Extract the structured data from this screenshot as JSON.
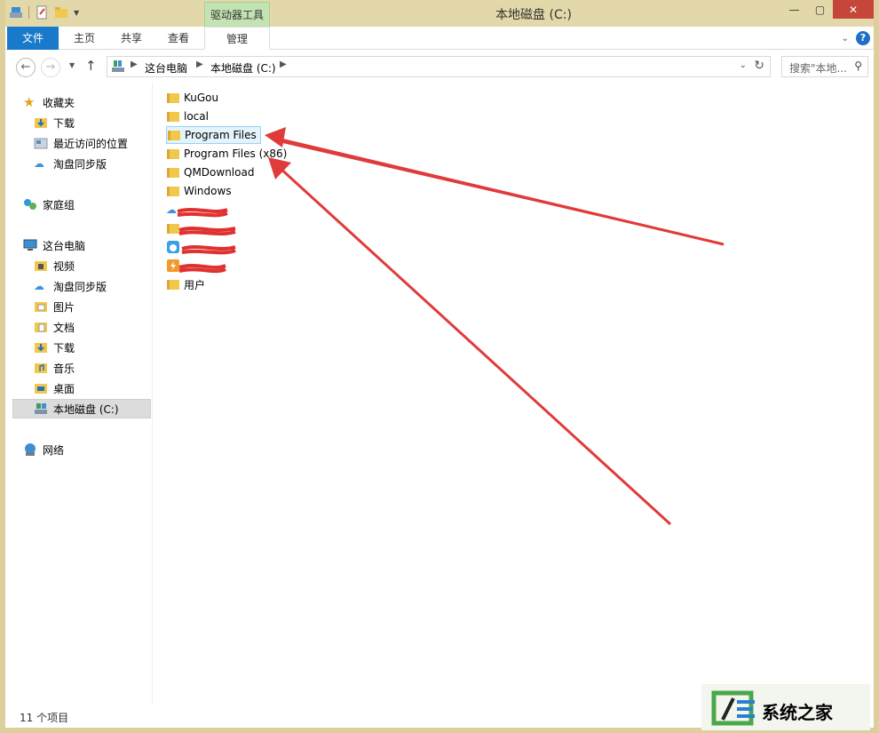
{
  "window": {
    "title": "本地磁盘 (C:)"
  },
  "ribbon": {
    "context_group": "驱动器工具",
    "tabs": [
      "文件",
      "主页",
      "共享",
      "查看",
      "管理"
    ]
  },
  "address": {
    "crumbs": [
      "这台电脑",
      "本地磁盘 (C:)"
    ]
  },
  "search": {
    "placeholder": "搜索\"本地..."
  },
  "sidebar": {
    "favorites": {
      "label": "收藏夹",
      "items": [
        "下载",
        "最近访问的位置",
        "淘盘同步版"
      ]
    },
    "homegroup": "家庭组",
    "thispc": {
      "label": "这台电脑",
      "items": [
        "视频",
        "淘盘同步版",
        "图片",
        "文档",
        "下载",
        "音乐",
        "桌面",
        "本地磁盘 (C:)"
      ]
    },
    "network": "网络"
  },
  "files": [
    "KuGou",
    "local",
    "Program Files",
    "Program Files (x86)",
    "QMDownload",
    "Windows",
    "",
    "",
    "",
    "",
    "用户"
  ],
  "status": {
    "count": "11 个项目"
  },
  "watermark": {
    "text": "系统之家"
  },
  "colors": {
    "file_tab": "#1979ca",
    "context_tab": "#c3e4b2",
    "frame": "#dccf9c",
    "close": "#c7463a",
    "arrow": "#e03a3a"
  }
}
